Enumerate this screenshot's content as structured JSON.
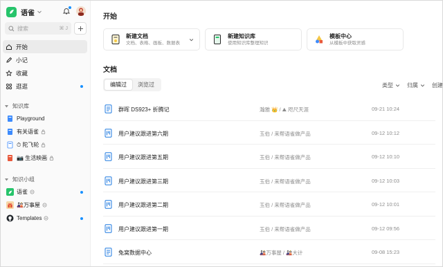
{
  "sidebar": {
    "brand_name": "语雀",
    "search": {
      "placeholder": "搜索",
      "shortcut": "⌘ J"
    },
    "nav": [
      {
        "label": "开始",
        "icon": "home-icon",
        "active": true
      },
      {
        "label": "小记",
        "icon": "pen-icon"
      },
      {
        "label": "收藏",
        "icon": "star-icon"
      },
      {
        "label": "逛逛",
        "icon": "grid-icon",
        "has_dot": true
      }
    ],
    "kb_section": {
      "title": "知识库",
      "items": [
        {
          "label": "Playground",
          "icon": "book-blue-icon"
        },
        {
          "label": "有关语雀",
          "icon": "book-blue-icon"
        },
        {
          "label": "⏱ 陀飞轮",
          "icon": "book-white-icon"
        },
        {
          "label": "📷 生活映画",
          "icon": "book-red-icon"
        }
      ]
    },
    "group_section": {
      "title": "知识小组",
      "items": [
        {
          "label": "语雀",
          "icon": "yuque-group-icon",
          "has_dot": true
        },
        {
          "label": "🎎万事屋",
          "icon": "gift-group-icon",
          "has_dot": false
        },
        {
          "label": "Templates",
          "icon": "github-group-icon",
          "has_dot": true
        }
      ]
    }
  },
  "main": {
    "start_title": "开始",
    "cards": [
      {
        "title": "新建文档",
        "subtitle": "文档、表格、画板、数据表",
        "icon": "new-doc-icon",
        "has_chevron": true
      },
      {
        "title": "新建知识库",
        "subtitle": "使用知识库整理知识",
        "icon": "new-kb-icon"
      },
      {
        "title": "模板中心",
        "subtitle": "从模板中获取灵感",
        "icon": "template-icon"
      }
    ],
    "docs_title": "文档",
    "tabs": [
      {
        "label": "编辑过",
        "active": true
      },
      {
        "label": "浏览过",
        "active": false
      }
    ],
    "filters": [
      "类型",
      "归属",
      "创建者"
    ],
    "docs": [
      {
        "name": "群晖 DS923+ 折腾记",
        "kb": "瀚雅 👑 / ⛰ 咫尺天涯",
        "time": "09-21 10:24",
        "type": "doc"
      },
      {
        "name": "用户建议跟进第六期",
        "kb": "玉伯 / 来帮语雀做产品",
        "time": "09-12 10:12",
        "type": "board"
      },
      {
        "name": "用户建议跟进第五期",
        "kb": "玉伯 / 来帮语雀做产品",
        "time": "09-12 10:10",
        "type": "board"
      },
      {
        "name": "用户建议跟进第三期",
        "kb": "玉伯 / 来帮语雀做产品",
        "time": "09-12 10:03",
        "type": "board"
      },
      {
        "name": "用户建议跟进第二期",
        "kb": "玉伯 / 来帮语雀做产品",
        "time": "09-12 10:01",
        "type": "board"
      },
      {
        "name": "用户建议跟进第一期",
        "kb": "玉伯 / 来帮语雀做产品",
        "time": "09-12 09:56",
        "type": "board"
      },
      {
        "name": "兔窝数据中心",
        "kb": "🎎万事屋 / 🎎大计",
        "time": "09-08 15:23",
        "type": "doc"
      }
    ]
  },
  "colors": {
    "accent": "#1890ff",
    "brand_green": "#27c46b"
  }
}
